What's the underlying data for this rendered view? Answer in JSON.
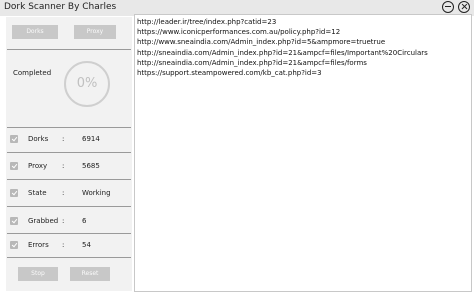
{
  "window": {
    "title": "Dork Scanner By Charles"
  },
  "buttons": {
    "dorks": "Dorks",
    "proxy": "Proxy",
    "stop": "Stop",
    "reset": "Reset"
  },
  "progress": {
    "label": "Completed",
    "percent_text": "0%",
    "value": 0
  },
  "stats": [
    {
      "label": "Dorks",
      "value": "6914",
      "checked": true
    },
    {
      "label": "Proxy",
      "value": "5685",
      "checked": true
    },
    {
      "label": "State",
      "value": "Working",
      "checked": true
    },
    {
      "label": "Grabbed",
      "value": "6",
      "checked": true
    },
    {
      "label": "Errors",
      "value": "54",
      "checked": true
    }
  ],
  "colon": ":",
  "results": [
    "http://leader.ir/tree/index.php?catid=23",
    "https://www.iconicperformances.com.au/policy.php?id=12",
    "http://www.sneaindia.com/Admin_index.php?id=5&ampmore=truetrue",
    "http://sneaindia.com/Admin_index.php?id=21&ampcf=files/Important%20Circulars",
    "http://sneaindia.com/Admin_index.php?id=21&ampcf=files/forms",
    "https://support.steampowered.com/kb_cat.php?id=3"
  ]
}
